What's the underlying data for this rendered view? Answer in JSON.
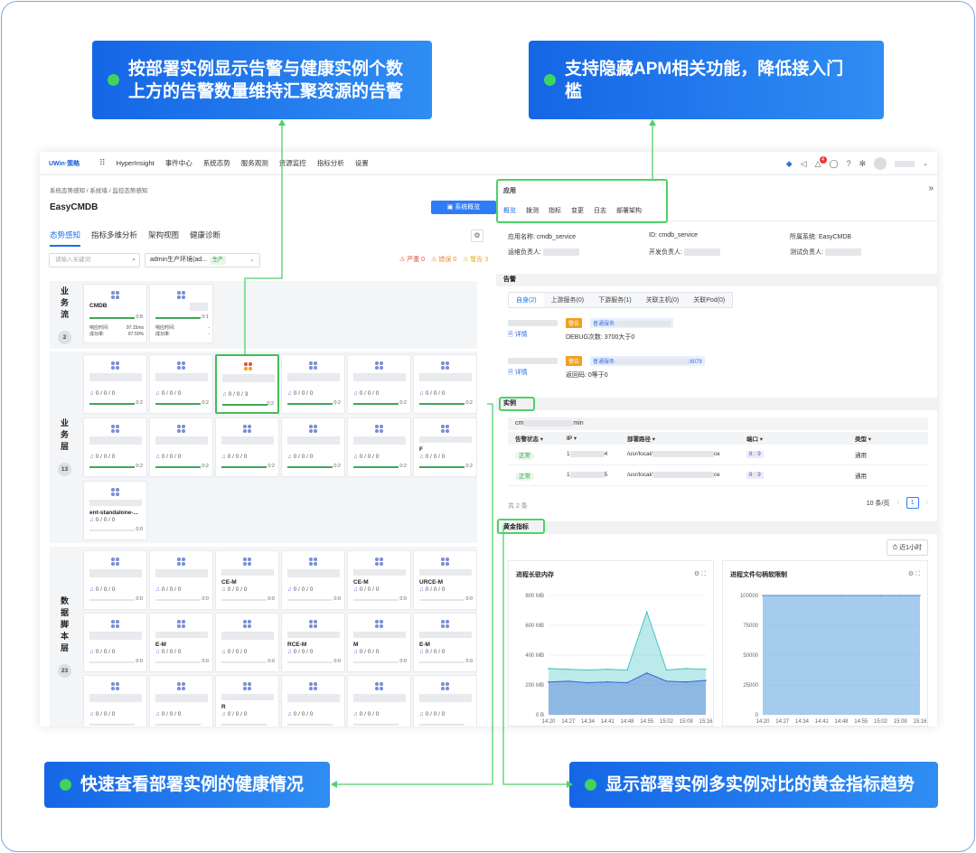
{
  "callouts": {
    "top_left": [
      "按部署实例显示告警与健康实例个数",
      "上方的告警数量维持汇聚资源的告警"
    ],
    "top_right": [
      "支持隐藏APM相关功能，降低接入门",
      "槛"
    ],
    "bottom_left": "快速查看部署实例的健康情况",
    "bottom_right": "显示部署实例多实例对比的黄金指标趋势"
  },
  "topbar": {
    "logo": "UWin·策略",
    "app": "HyperInsight",
    "nav": [
      "事件中心",
      "系统态势",
      "服务观测",
      "资源监控",
      "指标分析",
      "设置"
    ],
    "notify_count": "4"
  },
  "left": {
    "breadcrumb": "系统态势感知 / 系统墙 / 监控态势感知",
    "title": "EasyCMDB",
    "overview_btn": "系统概览",
    "tabs": [
      "态势感知",
      "指标多维分析",
      "架构视图",
      "健康诊断"
    ],
    "search_placeholder": "请输入关键词",
    "env": "admin生产环境(ad...",
    "env_tag": "生产",
    "legend": {
      "severe": "严重 0",
      "error": "错误 0",
      "warn": "警告 3"
    },
    "layers": [
      {
        "name": "业务流",
        "count": "2"
      },
      {
        "name": "业务层",
        "count": "13"
      },
      {
        "name": "数据脚本层",
        "count": "23"
      }
    ],
    "flow_card": {
      "name": "CMDB",
      "bar": "0:8",
      "time_label": "响应时间:",
      "time": "97.15ms",
      "rate_label": "成功率:",
      "rate": "87.50%"
    },
    "flow_card2": {
      "bar": "0:1",
      "time": "-",
      "rate": "-"
    },
    "alarm_text": "0 / 0 / 0",
    "alarm_sel": "0 / 0 / 3",
    "bar_02": "0:2",
    "bar_00": "0:0",
    "card_f": "F",
    "card_ent": "ent-standalone-...",
    "data_names": [
      "",
      "",
      "CE-M",
      "",
      "CE-M",
      "URCE-M",
      "",
      "E-M",
      "",
      "RCE-M",
      "M",
      "E-M",
      "",
      "",
      "R",
      "",
      "",
      ""
    ]
  },
  "right": {
    "section_app": "应用",
    "app_tabs": [
      "概览",
      "拨测",
      "指标",
      "变更",
      "日志",
      "部署架构"
    ],
    "app_name": "应用名称: cmdb_service",
    "app_id": "ID: cmdb_service",
    "app_sys": "所属系统: EasyCMDB",
    "ops_owner": "运维负责人:",
    "dev_owner": "开发负责人:",
    "test_owner": "测试负责人:",
    "section_alarm": "告警",
    "alarm_tabs": [
      "自身(2)",
      "上游服务(0)",
      "下游服务(1)",
      "关联主机(0)",
      "关联Pod(0)"
    ],
    "alarm_level": "警告",
    "alarm_type": "普通服务:",
    "alarm1_detail": "详情",
    "alarm1_text": "DEBUG次数: 3700大于0",
    "alarm2_port": ":8079",
    "alarm2_text": "返回码: 0等于0",
    "section_inst": "实例",
    "inst_group": "cm",
    "inst_group_tail": "min",
    "headers": [
      "告警状态",
      "IP",
      "部署路径",
      "端口",
      "类型"
    ],
    "rows": [
      {
        "status": "正常",
        "ip": "1",
        "ip_tail": "4",
        "path": "/usr/local/",
        "path_tail": "ce",
        "port": "8",
        "port_tail": "9",
        "type": "通用"
      },
      {
        "status": "正常",
        "ip": "1",
        "ip_tail": "5",
        "path": "/usr/local/",
        "path_tail": "ce",
        "port": "8",
        "port_tail": "9",
        "type": "通用"
      }
    ],
    "total": "共 2 条",
    "page_size": "10 条/页",
    "page": "1",
    "section_gold": "黄金指标",
    "time_btn": "近1小时",
    "chart1_title": "进程长驻内存",
    "chart2_title": "进程文件句柄软限制"
  },
  "chart_data": [
    {
      "type": "area",
      "title": "进程长驻内存",
      "x": [
        "14:20",
        "14:27",
        "14:34",
        "14:41",
        "14:48",
        "14:55",
        "15:02",
        "15:09",
        "15:16"
      ],
      "yticks": [
        "0 B",
        "200 MB",
        "400 MB",
        "600 MB",
        "800 MB"
      ],
      "ylim": [
        0,
        800
      ],
      "series": [
        {
          "values": [
            310,
            305,
            300,
            305,
            300,
            690,
            300,
            310,
            305
          ]
        },
        {
          "values": [
            220,
            225,
            215,
            220,
            215,
            280,
            225,
            220,
            230
          ]
        }
      ]
    },
    {
      "type": "area",
      "title": "进程文件句柄软限制",
      "x": [
        "14:20",
        "14:27",
        "14:34",
        "14:41",
        "14:48",
        "14:55",
        "15:02",
        "15:09",
        "15:16"
      ],
      "yticks": [
        "0",
        "25000",
        "50000",
        "75000",
        "100000"
      ],
      "ylim": [
        0,
        100000
      ],
      "series": [
        {
          "values": [
            100000,
            100000,
            100000,
            100000,
            100000,
            100000,
            100000,
            100000,
            100000
          ]
        }
      ]
    }
  ]
}
